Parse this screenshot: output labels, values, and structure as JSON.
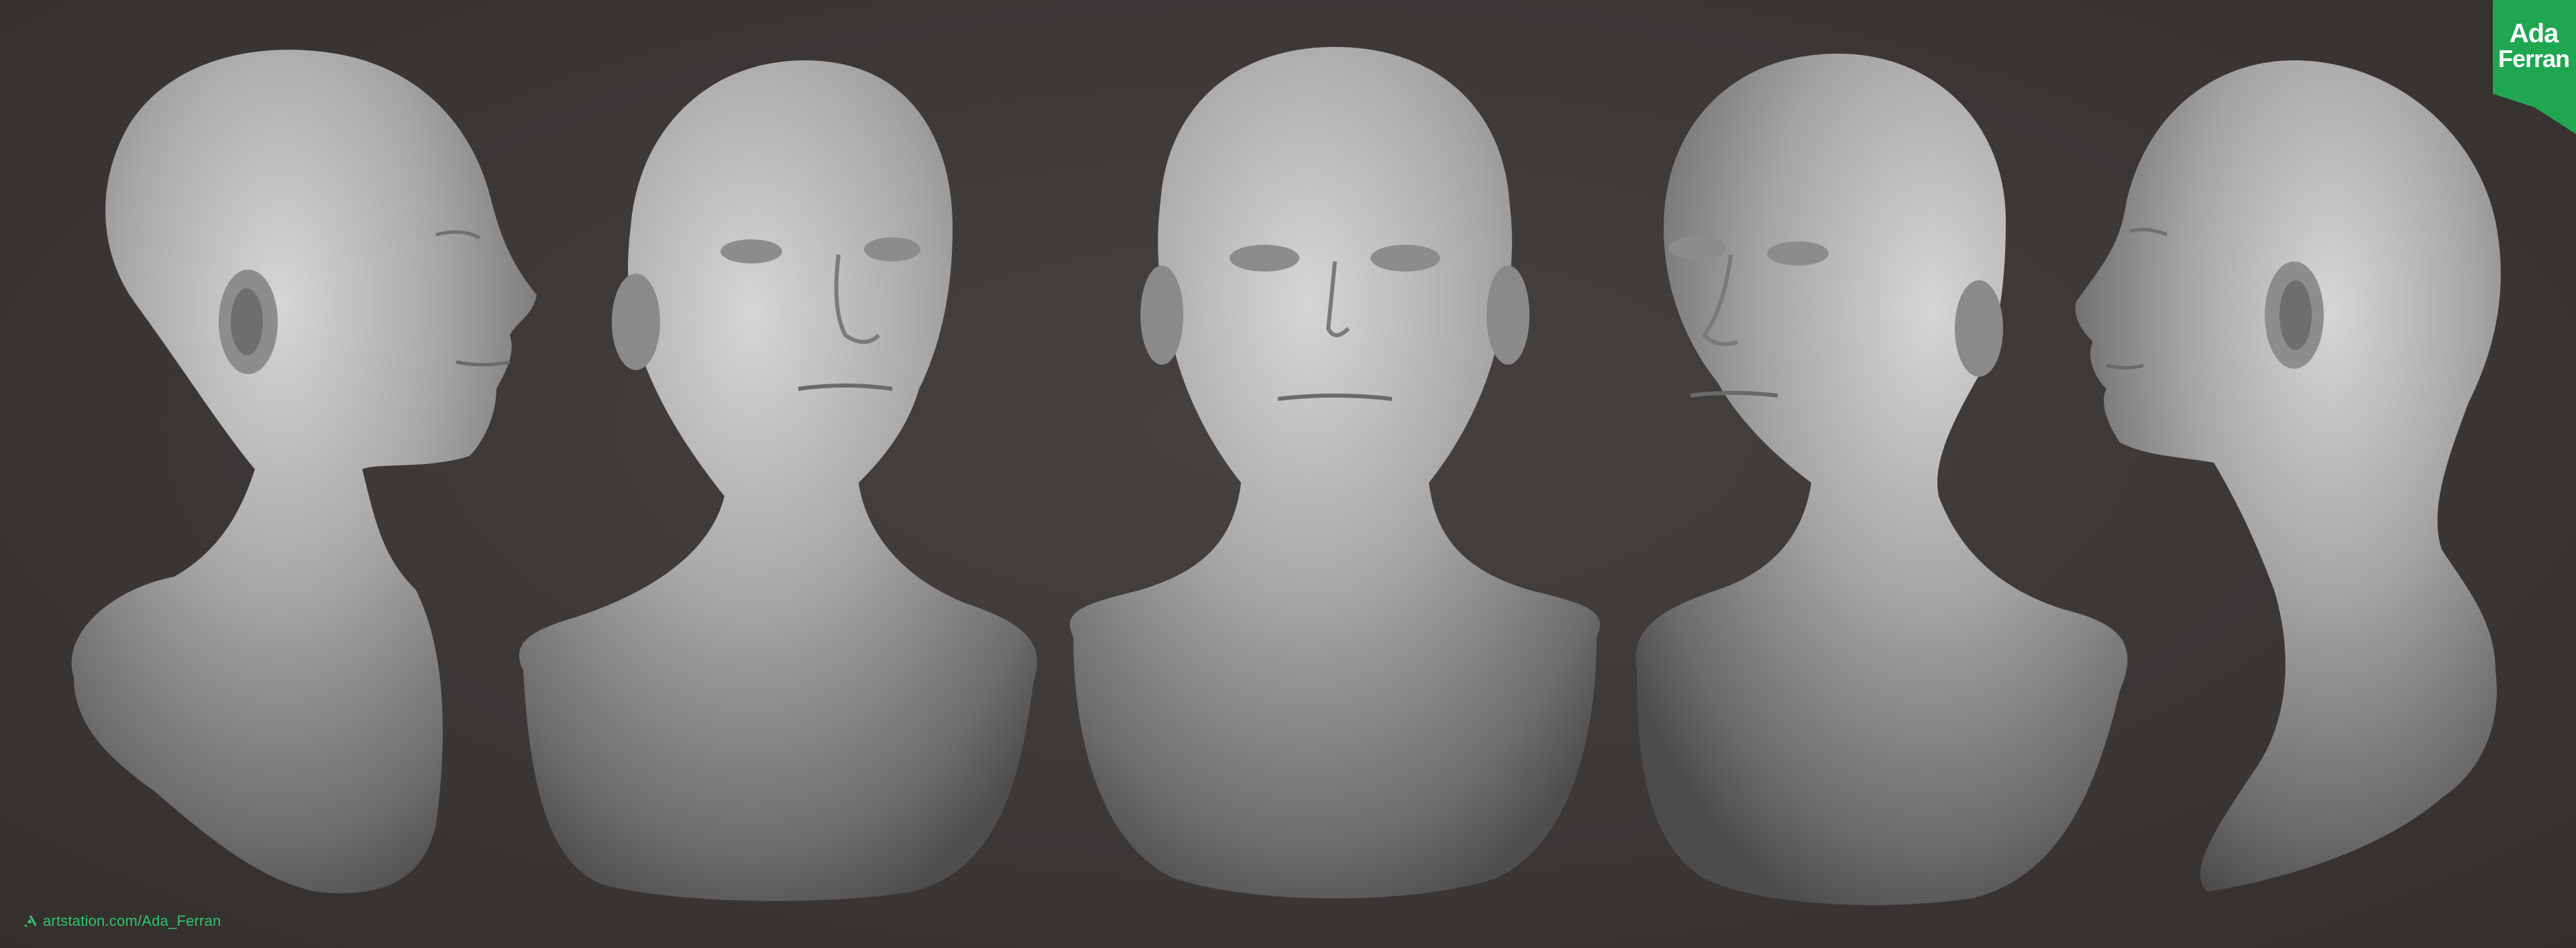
{
  "watermark": {
    "url": "artstation.com/Ada_Ferran",
    "icon": "artstation-icon",
    "color": "#31c46a"
  },
  "logo": {
    "line1": "Ada",
    "line2": "Ferran",
    "bg_color": "#1fa651",
    "text_color": "#ffffff"
  },
  "colors": {
    "background": "#3d3a38",
    "clay_light": "#c9c9c9",
    "clay_mid": "#9a9a9a",
    "clay_dark": "#5a5a5a"
  },
  "views": [
    {
      "name": "profile-right-view"
    },
    {
      "name": "three-quarter-right-view"
    },
    {
      "name": "front-view"
    },
    {
      "name": "three-quarter-left-view"
    },
    {
      "name": "profile-left-view"
    }
  ]
}
